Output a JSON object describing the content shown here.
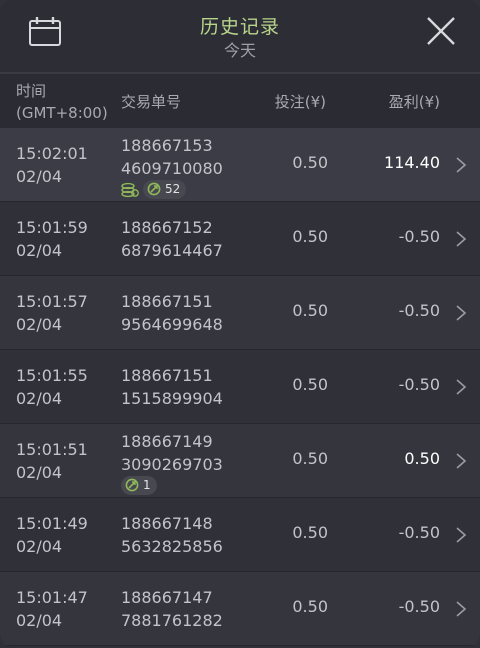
{
  "header": {
    "title": "历史记录",
    "subtitle": "今天",
    "calendar_icon": "calendar-icon",
    "close_icon": "close-icon"
  },
  "columns": {
    "time": [
      "时间",
      "(GMT+8:00)"
    ],
    "order": "交易单号",
    "bet": "投注(¥)",
    "profit": "盈利(¥)"
  },
  "rows": [
    {
      "time": "15:02:01",
      "date": "02/04",
      "order_a": "188667153",
      "order_b": "4609710080",
      "bet": "0.50",
      "profit": "114.40",
      "win": true,
      "coin_badge": true,
      "free_spins": "52"
    },
    {
      "time": "15:01:59",
      "date": "02/04",
      "order_a": "188667152",
      "order_b": "6879614467",
      "bet": "0.50",
      "profit": "-0.50",
      "win": false
    },
    {
      "time": "15:01:57",
      "date": "02/04",
      "order_a": "188667151",
      "order_b": "9564699648",
      "bet": "0.50",
      "profit": "-0.50",
      "win": false
    },
    {
      "time": "15:01:55",
      "date": "02/04",
      "order_a": "188667151",
      "order_b": "1515899904",
      "bet": "0.50",
      "profit": "-0.50",
      "win": false
    },
    {
      "time": "15:01:51",
      "date": "02/04",
      "order_a": "188667149",
      "order_b": "3090269703",
      "bet": "0.50",
      "profit": "0.50",
      "win": true,
      "coin_badge": false,
      "free_spins": "1"
    },
    {
      "time": "15:01:49",
      "date": "02/04",
      "order_a": "188667148",
      "order_b": "5632825856",
      "bet": "0.50",
      "profit": "-0.50",
      "win": false
    },
    {
      "time": "15:01:47",
      "date": "02/04",
      "order_a": "188667147",
      "order_b": "7881761282",
      "bet": "0.50",
      "profit": "-0.50",
      "win": false
    }
  ],
  "colors": {
    "title": "#b9d48b",
    "background": "#2f3038",
    "win_text": "#ffffff",
    "badge_green": "#8fb85a"
  }
}
